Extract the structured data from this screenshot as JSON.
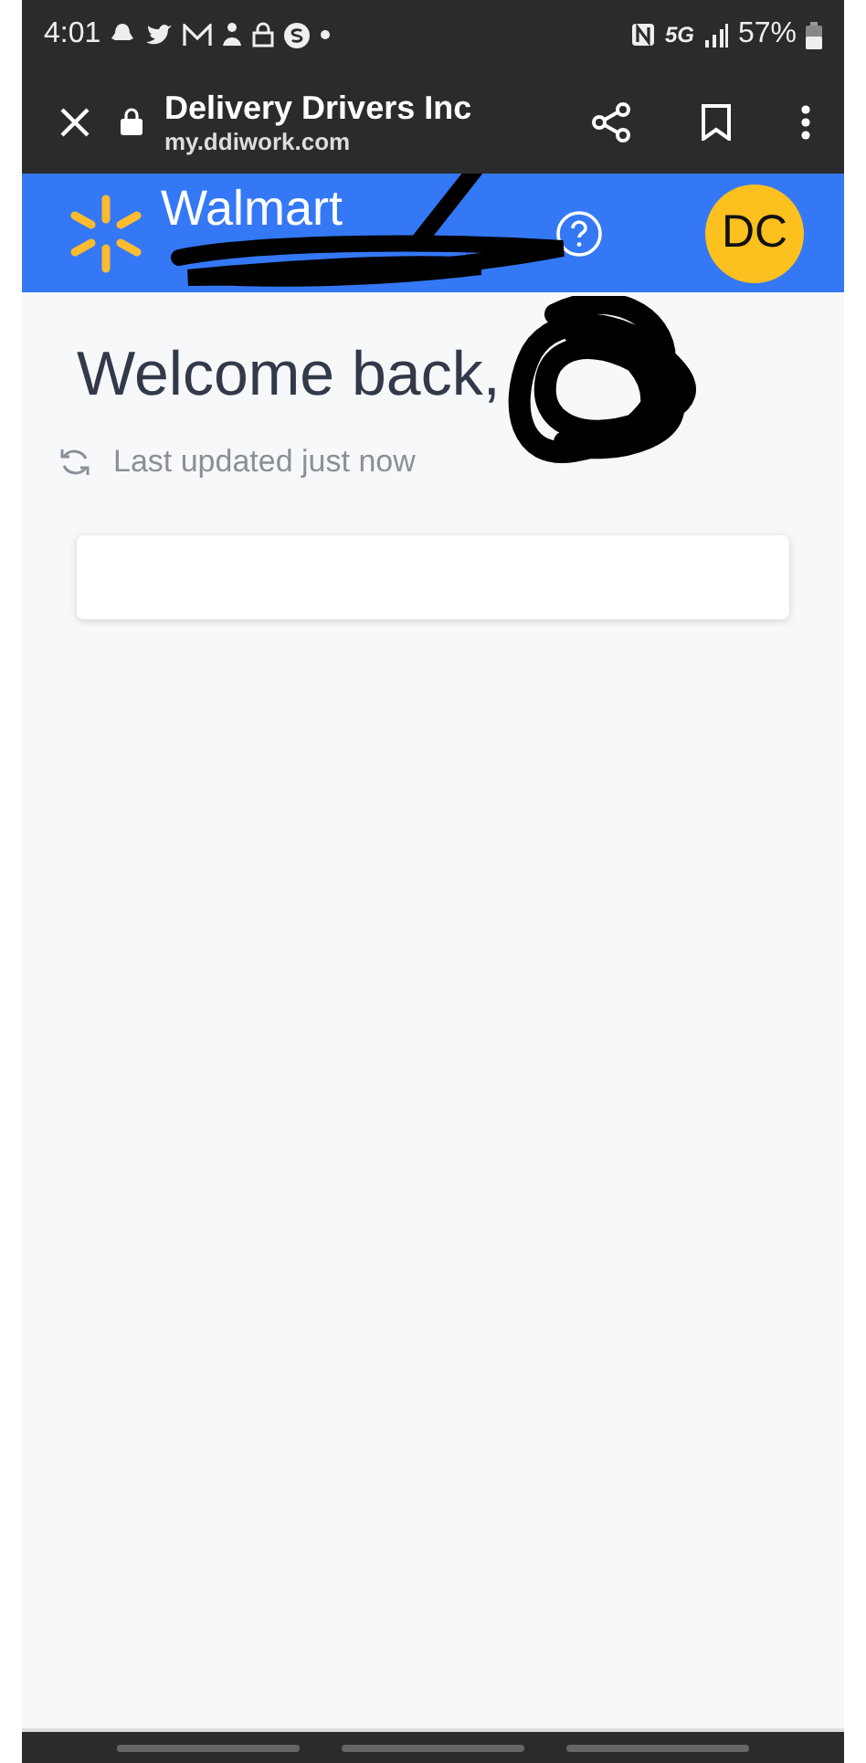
{
  "status_bar": {
    "time": "4:01",
    "network": "5G",
    "battery": "57%"
  },
  "browser_toolbar": {
    "title": "Delivery Drivers Inc",
    "url": "my.ddiwork.com"
  },
  "app_header": {
    "brand": "Walmart",
    "avatar": "DC"
  },
  "content": {
    "greeting": "Welcome back,",
    "updated": "Last updated just now",
    "card": {
      "kind": "empty"
    }
  }
}
